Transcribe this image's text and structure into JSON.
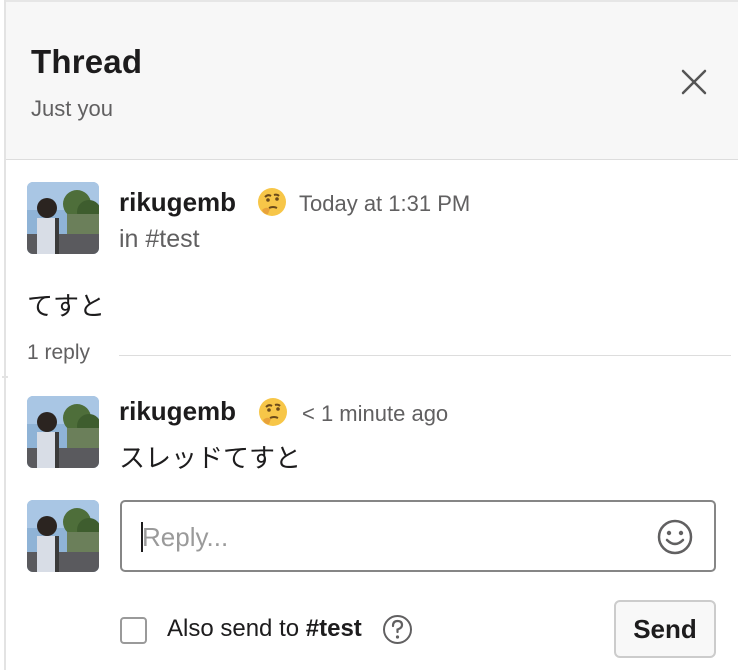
{
  "header": {
    "title": "Thread",
    "subtitle": "Just you",
    "close_icon": "close-icon"
  },
  "parent_message": {
    "author": "rikugemb",
    "status_emoji": "thinking-face",
    "timestamp": "Today at 1:31 PM",
    "channel": "in #test",
    "text": "てすと"
  },
  "replies": {
    "count_label": "1 reply",
    "items": [
      {
        "author": "rikugemb",
        "status_emoji": "thinking-face",
        "timestamp": "< 1 minute ago",
        "text": "スレッドてすと"
      }
    ]
  },
  "composer": {
    "placeholder": "Reply...",
    "emoji_icon": "smiley-icon",
    "also_send_prefix": "Also send to ",
    "also_send_channel": "#test",
    "help_icon": "question-circle-icon",
    "send_label": "Send"
  },
  "colors": {
    "header_bg": "#f7f7f7",
    "text": "#1d1c1d",
    "muted": "#616061",
    "border": "#dddddd"
  }
}
